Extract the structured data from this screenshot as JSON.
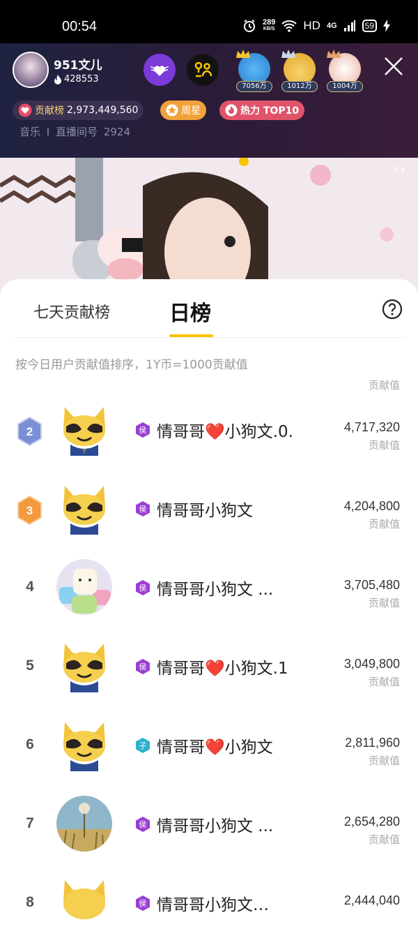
{
  "status_bar": {
    "time": "00:54",
    "speed_value": "289",
    "speed_unit": "KB/S",
    "network": "HD",
    "signal_gen": "4G",
    "battery": "59"
  },
  "header": {
    "host_name": "951文儿",
    "fans": "428553",
    "top_fans": [
      {
        "tag": "7056万",
        "color": "#3aa0ea"
      },
      {
        "tag": "1012万",
        "color": "#f1c23a"
      },
      {
        "tag": "1004万",
        "color": "#f0d0c8"
      }
    ],
    "contribution_label": "贡献榜",
    "contribution_value": "2,973,449,560",
    "weekly_star": "周星",
    "hot_label": "热力 TOP10",
    "category": "音乐",
    "room_label": "直播间号",
    "room_number": "2924"
  },
  "panel": {
    "tab_seven_day": "七天贡献榜",
    "tab_daily": "日榜",
    "description": "按今日用户贡献值排序，1Y币=1000贡献值",
    "score_label": "贡献值",
    "entries": [
      {
        "rank": "2",
        "name": "情哥哥❤️小狗文.0.",
        "score": "4,717,320",
        "level": "侯",
        "avatar": "yy"
      },
      {
        "rank": "3",
        "name": "情哥哥小狗文",
        "score": "4,204,800",
        "level": "侯",
        "avatar": "yy"
      },
      {
        "rank": "4",
        "name": "情哥哥小狗文   ...",
        "score": "3,705,480",
        "level": "侯",
        "avatar": "photo1"
      },
      {
        "rank": "5",
        "name": "情哥哥❤️小狗文.1",
        "score": "3,049,800",
        "level": "侯",
        "avatar": "yy"
      },
      {
        "rank": "6",
        "name": "情哥哥❤️小狗文",
        "score": "2,811,960",
        "level": "子",
        "avatar": "yy"
      },
      {
        "rank": "7",
        "name": "情哥哥小狗文   ...",
        "score": "2,654,280",
        "level": "侯",
        "avatar": "photo2"
      },
      {
        "rank": "8",
        "name": "情哥哥小狗文…",
        "score": "2,444,040",
        "level": "侯",
        "avatar": "yy"
      }
    ]
  },
  "colors": {
    "accent_yellow": "#f7c400",
    "level_purple": "#9b3fd4",
    "level_cyan": "#2bb3c9",
    "rank2": "#7c8fd6",
    "rank3": "#f39a3b"
  }
}
